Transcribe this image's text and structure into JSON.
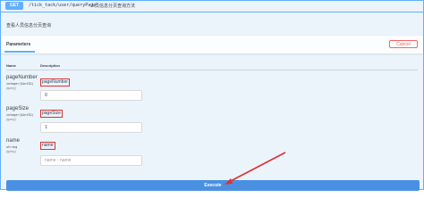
{
  "operation": {
    "method": "GET",
    "path": "/tick_tack/user/queryPage",
    "summary": "人员信息分页查询方法",
    "description": "查看人员信息分页查询"
  },
  "parameters_section": {
    "tab_label": "Parameters",
    "cancel_label": "Cancel",
    "col_name": "Name",
    "col_description": "Description"
  },
  "parameters": [
    {
      "name": "pageNumber",
      "type": "integer($int32)",
      "in": "(query)",
      "label": "pageNumber",
      "value": "0",
      "placeholder": ""
    },
    {
      "name": "pageSize",
      "type": "integer($int32)",
      "in": "(query)",
      "label": "pageSize",
      "value": "1",
      "placeholder": ""
    },
    {
      "name": "name",
      "type": "string",
      "in": "(query)",
      "label": "name",
      "value": "",
      "placeholder": "name - name"
    }
  ],
  "execute_label": "Execute",
  "colors": {
    "get_accent": "#61affe",
    "execute_bg": "#4990e2",
    "cancel": "#ff6060",
    "annotation_red": "#e03030"
  }
}
